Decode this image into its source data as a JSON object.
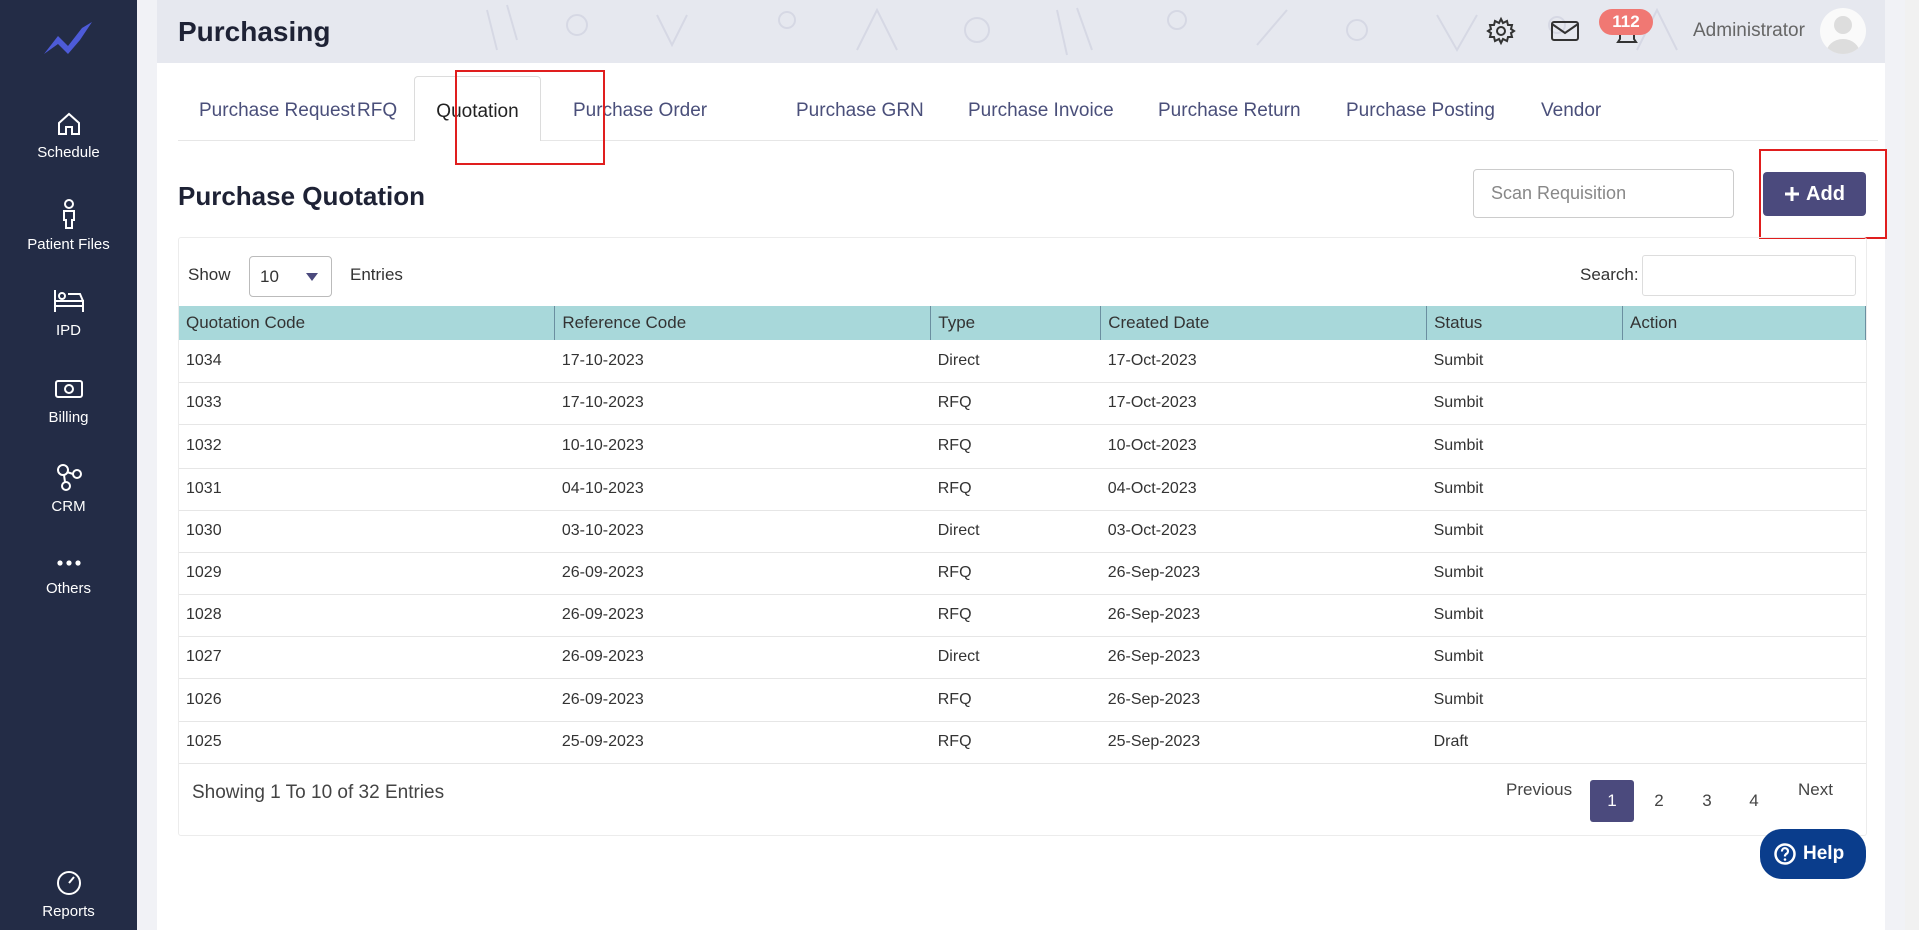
{
  "sidebar": {
    "items": [
      {
        "label": "Schedule",
        "icon": "home-icon"
      },
      {
        "label": "Patient Files",
        "icon": "person-icon"
      },
      {
        "label": "IPD",
        "icon": "bed-icon"
      },
      {
        "label": "Billing",
        "icon": "cash-icon"
      },
      {
        "label": "CRM",
        "icon": "network-icon"
      },
      {
        "label": "Others",
        "icon": "more-dots-icon"
      },
      {
        "label": "Reports",
        "icon": "gauge-icon"
      }
    ]
  },
  "header": {
    "title": "Purchasing",
    "notification_count": "112",
    "user_name": "Administrator"
  },
  "tabs": [
    {
      "label": "Purchase Request"
    },
    {
      "label": "RFQ"
    },
    {
      "label": "Quotation"
    },
    {
      "label": "Purchase Order"
    },
    {
      "label": "Purchase GRN"
    },
    {
      "label": "Purchase Invoice"
    },
    {
      "label": "Purchase Return"
    },
    {
      "label": "Purchase Posting"
    },
    {
      "label": "Vendor"
    }
  ],
  "active_tab": "Quotation",
  "page": {
    "title": "Purchase Quotation",
    "scan_placeholder": "Scan Requisition",
    "add_label": "Add"
  },
  "table_controls": {
    "show_label": "Show",
    "entries_value": "10",
    "entries_label": "Entries",
    "search_label": "Search:"
  },
  "table": {
    "columns": [
      "Quotation Code",
      "Reference Code",
      "Type",
      "Created Date",
      "Status",
      "Action"
    ],
    "rows": [
      [
        "1034",
        "17-10-2023",
        "Direct",
        "17-Oct-2023",
        "Sumbit",
        ""
      ],
      [
        "1033",
        "17-10-2023",
        "RFQ",
        "17-Oct-2023",
        "Sumbit",
        ""
      ],
      [
        "1032",
        "10-10-2023",
        "RFQ",
        "10-Oct-2023",
        "Sumbit",
        ""
      ],
      [
        "1031",
        "04-10-2023",
        "RFQ",
        "04-Oct-2023",
        "Sumbit",
        ""
      ],
      [
        "1030",
        "03-10-2023",
        "Direct",
        "03-Oct-2023",
        "Sumbit",
        ""
      ],
      [
        "1029",
        "26-09-2023",
        "RFQ",
        "26-Sep-2023",
        "Sumbit",
        ""
      ],
      [
        "1028",
        "26-09-2023",
        "RFQ",
        "26-Sep-2023",
        "Sumbit",
        ""
      ],
      [
        "1027",
        "26-09-2023",
        "Direct",
        "26-Sep-2023",
        "Sumbit",
        ""
      ],
      [
        "1026",
        "26-09-2023",
        "RFQ",
        "26-Sep-2023",
        "Sumbit",
        ""
      ],
      [
        "1025",
        "25-09-2023",
        "RFQ",
        "25-Sep-2023",
        "Draft",
        ""
      ]
    ]
  },
  "pagination": {
    "summary": "Showing 1 To 10 of 32 Entries",
    "previous": "Previous",
    "pages": [
      "1",
      "2",
      "3",
      "4"
    ],
    "current": "1",
    "next": "Next"
  },
  "help": {
    "label": "Help"
  },
  "colors": {
    "sidebar": "#232c46",
    "accent": "#4b4a7d",
    "table_header": "#a8d8da",
    "badge": "#f07873",
    "help": "#0a3d8c",
    "highlight": "#e01e1e"
  }
}
